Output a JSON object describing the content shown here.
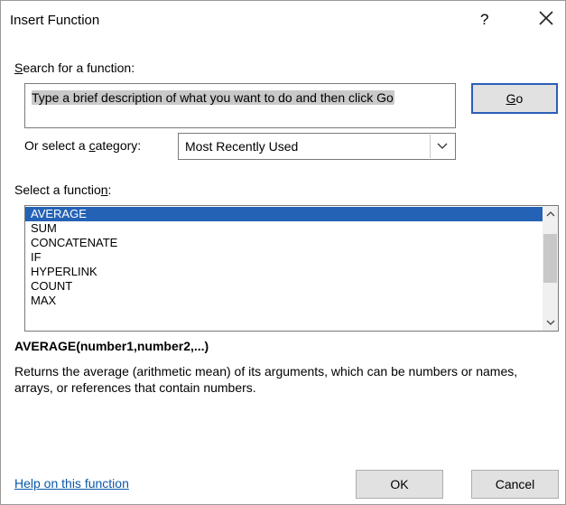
{
  "dialog": {
    "title": "Insert Function",
    "help_glyph": "?",
    "close_glyph": "×"
  },
  "search": {
    "label": "Search for a function:",
    "text": "Type a brief description of what you want to do and then click Go",
    "go_label": "Go"
  },
  "category": {
    "label": "Or select a category:",
    "selected": "Most Recently Used"
  },
  "functions": {
    "label": "Select a function:",
    "items": [
      {
        "label": "AVERAGE",
        "selected": true
      },
      {
        "label": "SUM"
      },
      {
        "label": "CONCATENATE"
      },
      {
        "label": "IF"
      },
      {
        "label": "HYPERLINK"
      },
      {
        "label": "COUNT"
      },
      {
        "label": "MAX"
      }
    ]
  },
  "details": {
    "signature": "AVERAGE(number1,number2,...)",
    "description": "Returns the average (arithmetic mean) of its arguments, which can be numbers or names, arrays, or references that contain numbers."
  },
  "footer": {
    "help_link": "Help on this function",
    "ok_label": "OK",
    "cancel_label": "Cancel"
  },
  "colors": {
    "selection": "#2462b6",
    "link": "#0a57a8",
    "default_button_border": "#2b5fb5"
  },
  "icons": {
    "close": "close-icon",
    "dropdown": "chevron-down-icon",
    "scroll_up": "chevron-up-icon",
    "scroll_down": "chevron-down-icon"
  }
}
